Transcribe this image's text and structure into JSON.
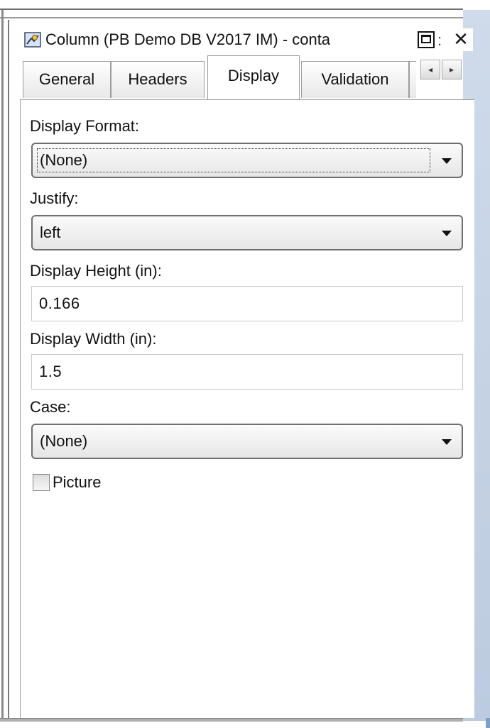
{
  "window": {
    "title": "Column (PB Demo DB V2017 IM) - conta",
    "title_separator": ":",
    "maximize_icon": "maximize-icon",
    "close_icon": "close-icon",
    "close_glyph": "✕"
  },
  "tabs": [
    {
      "label": "General",
      "active": false
    },
    {
      "label": "Headers",
      "active": false
    },
    {
      "label": "Display",
      "active": true
    },
    {
      "label": "Validation",
      "active": false
    }
  ],
  "tab_scroll": {
    "left_glyph": "◂",
    "right_glyph": "▸"
  },
  "display": {
    "display_format": {
      "label": "Display Format:",
      "value": "(None)"
    },
    "justify": {
      "label": "Justify:",
      "value": "left"
    },
    "display_height": {
      "label": "Display Height (in):",
      "value": "0.166"
    },
    "display_width": {
      "label": "Display Width (in):",
      "value": "1.5"
    },
    "case": {
      "label": "Case:",
      "value": "(None)"
    },
    "picture": {
      "label": "Picture",
      "checked": false
    }
  }
}
